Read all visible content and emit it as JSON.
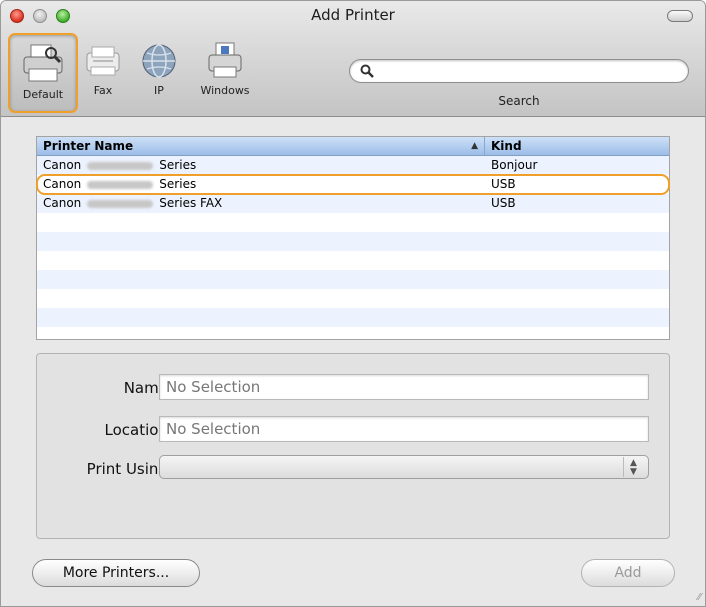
{
  "window": {
    "title": "Add Printer"
  },
  "toolbar": {
    "items": [
      {
        "label": "Default",
        "icon": "default-printer-icon"
      },
      {
        "label": "Fax",
        "icon": "fax-icon"
      },
      {
        "label": "IP",
        "icon": "globe-icon"
      },
      {
        "label": "Windows",
        "icon": "windows-printer-icon"
      }
    ],
    "search_label": "Search",
    "search_placeholder": ""
  },
  "table": {
    "columns": {
      "name": "Printer Name",
      "kind": "Kind"
    },
    "rows": [
      {
        "prefix": "Canon",
        "suffix": "Series",
        "kind": "Bonjour"
      },
      {
        "prefix": "Canon",
        "suffix": "Series",
        "kind": "USB"
      },
      {
        "prefix": "Canon",
        "suffix": "Series FAX",
        "kind": "USB"
      }
    ]
  },
  "details": {
    "name_label": "Name:",
    "name_value": "No Selection",
    "location_label": "Location:",
    "location_value": "No Selection",
    "print_using_label": "Print Using:",
    "print_using_value": ""
  },
  "buttons": {
    "more_printers": "More Printers...",
    "add": "Add"
  },
  "colors": {
    "highlight": "#f0a02a",
    "header": "#9cbde8",
    "stripe": "#edf3fe"
  }
}
